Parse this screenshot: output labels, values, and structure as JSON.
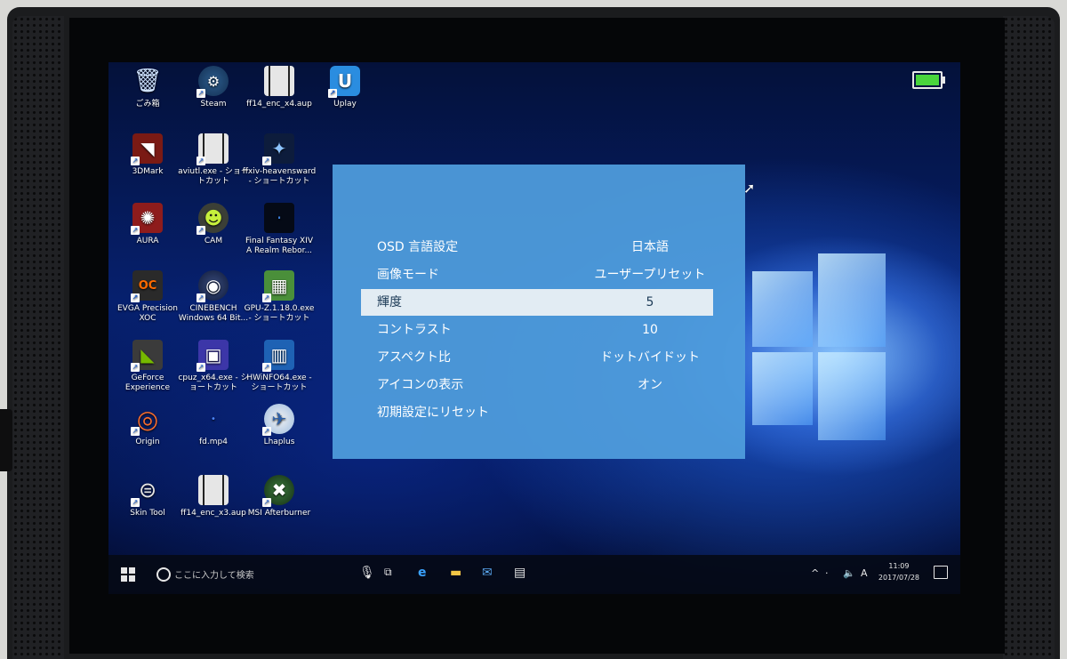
{
  "desktop": {
    "icons": [
      {
        "label": "ごみ箱",
        "glyph": "🗑",
        "style": "rb",
        "shortcut": false
      },
      {
        "label": "Steam",
        "glyph": "⚙",
        "style": "steam",
        "shortcut": true
      },
      {
        "label": "ff14_enc_x4.aup",
        "glyph": "",
        "style": "film",
        "shortcut": false
      },
      {
        "label": "Uplay",
        "glyph": "U",
        "style": "uplay",
        "shortcut": true
      },
      {
        "label": "3DMark",
        "glyph": "◥",
        "style": "mark3d",
        "shortcut": true
      },
      {
        "label": "aviutl.exe - ショートカット",
        "glyph": "",
        "style": "film",
        "shortcut": true
      },
      {
        "label": "ffxiv-heavensward - ショートカット",
        "glyph": "✦",
        "style": "ff",
        "shortcut": true
      },
      {
        "label": "AURA",
        "glyph": "✺",
        "style": "aura",
        "shortcut": true
      },
      {
        "label": "CAM",
        "glyph": "☻",
        "style": "cam",
        "shortcut": true
      },
      {
        "label": "Final Fantasy XIV A Realm Rebor...",
        "glyph": "·",
        "style": "ffxiv",
        "shortcut": false
      },
      {
        "label": "EVGA Precision XOC",
        "glyph": "OC",
        "style": "evga",
        "shortcut": true
      },
      {
        "label": "CINEBENCH Windows 64 Bit...",
        "glyph": "◉",
        "style": "cine",
        "shortcut": true
      },
      {
        "label": "GPU-Z.1.18.0.exe - ショートカット",
        "glyph": "▦",
        "style": "gpuz",
        "shortcut": true
      },
      {
        "label": "GeForce Experience",
        "glyph": "◣",
        "style": "gfe",
        "shortcut": true
      },
      {
        "label": "cpuz_x64.exe - ショートカット",
        "glyph": "▣",
        "style": "cpuz",
        "shortcut": true
      },
      {
        "label": "HWiNFO64.exe - ショートカット",
        "glyph": "▥",
        "style": "hwinfo",
        "shortcut": true
      },
      {
        "label": "Origin",
        "glyph": "◎",
        "style": "origin",
        "shortcut": true
      },
      {
        "label": "fd.mp4",
        "glyph": "•",
        "style": "mp4",
        "shortcut": false
      },
      {
        "label": "Lhaplus",
        "glyph": "✈",
        "style": "lhaplus",
        "shortcut": true
      },
      {
        "label": "Skin Tool",
        "glyph": "⊜",
        "style": "skin",
        "shortcut": true
      },
      {
        "label": "ff14_enc_x3.aup",
        "glyph": "",
        "style": "film",
        "shortcut": false
      },
      {
        "label": "MSI Afterburner",
        "glyph": "✖",
        "style": "msi",
        "shortcut": true
      }
    ]
  },
  "battery_level": 1.0,
  "osd": {
    "rows": [
      {
        "label": "OSD 言語設定",
        "value": "日本語",
        "selected": false
      },
      {
        "label": "画像モード",
        "value": "ユーザープリセット",
        "selected": false
      },
      {
        "label": "輝度",
        "value": "5",
        "selected": true
      },
      {
        "label": "コントラスト",
        "value": "10",
        "selected": false
      },
      {
        "label": "アスペクト比",
        "value": "ドットバイドット",
        "selected": false
      },
      {
        "label": "アイコンの表示",
        "value": "オン",
        "selected": false
      },
      {
        "label": "初期設定にリセット",
        "value": "",
        "selected": false
      }
    ]
  },
  "taskbar": {
    "search_placeholder": "ここに入力して検索",
    "ime_indicator": "A",
    "time": "11:09",
    "date": "2017/07/28"
  },
  "colors": {
    "osd_bg": "#509ede",
    "osd_selected": "#e2ecf3",
    "battery_fill": "#49d43c"
  }
}
